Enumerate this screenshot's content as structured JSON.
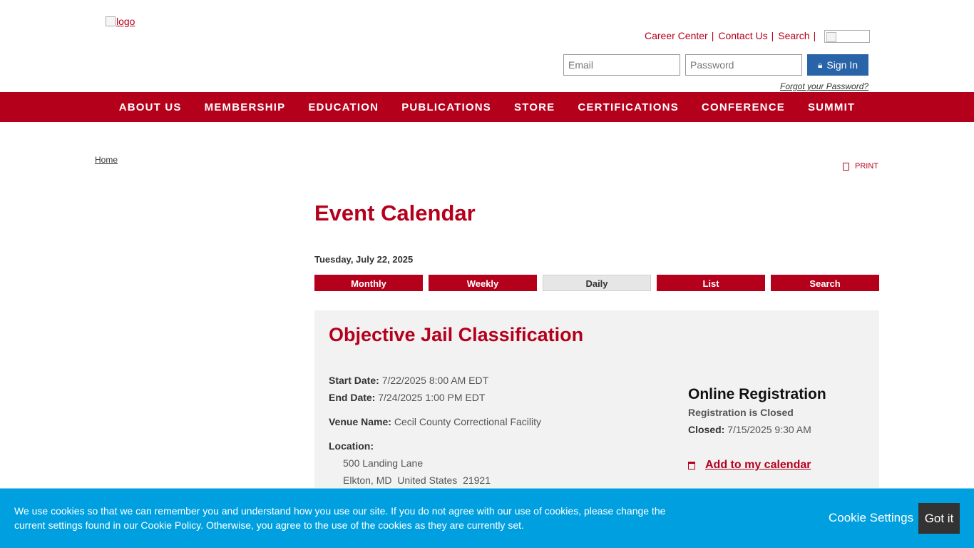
{
  "header": {
    "logo_alt": "logo",
    "util_links": [
      "Career Center",
      "Contact Us",
      "Search"
    ],
    "separator": "|",
    "email_placeholder": "Email",
    "password_placeholder": "Password",
    "signin_label": "Sign In",
    "forgot_label": "Forgot your Password?"
  },
  "nav": {
    "items": [
      "ABOUT US",
      "MEMBERSHIP",
      "EDUCATION",
      "PUBLICATIONS",
      "STORE",
      "CERTIFICATIONS",
      "CONFERENCE",
      "SUMMIT"
    ]
  },
  "breadcrumb": {
    "home": "Home"
  },
  "print_label": "PRINT",
  "main": {
    "title": "Event Calendar",
    "date": "Tuesday, July 22, 2025",
    "tabs": [
      "Monthly",
      "Weekly",
      "Daily",
      "List",
      "Search"
    ],
    "active_tab": "Daily"
  },
  "event": {
    "title": "Objective Jail Classification",
    "start_label": "Start Date:",
    "start_value": "7/22/2025 8:00 AM EDT",
    "end_label": "End Date:",
    "end_value": "7/24/2025 1:00 PM EDT",
    "venue_label": "Venue Name:",
    "venue_value": "Cecil County Correctional Facility",
    "location_label": "Location:",
    "address1": "500 Landing Lane",
    "address2": "Elkton, MD  United States  21921"
  },
  "registration": {
    "title": "Online Registration",
    "status": "Registration is Closed",
    "closed_label": "Closed:",
    "closed_value": "7/15/2025 9:30 AM",
    "add_calendar": "Add to my calendar"
  },
  "cookie": {
    "text": "We use cookies so that we can remember you and understand how you use our site. If you do not agree with our use of cookies, please change the current settings found in our Cookie Policy. Otherwise, you agree to the use of the cookies as they are currently set.",
    "settings_label": "Cookie Settings",
    "accept_label": "Got it"
  },
  "colors": {
    "brand_red": "#b5001c",
    "signin_blue": "#2a64a8",
    "cookie_blue": "#00a0e0",
    "panel_gray": "#f2f2f2"
  }
}
